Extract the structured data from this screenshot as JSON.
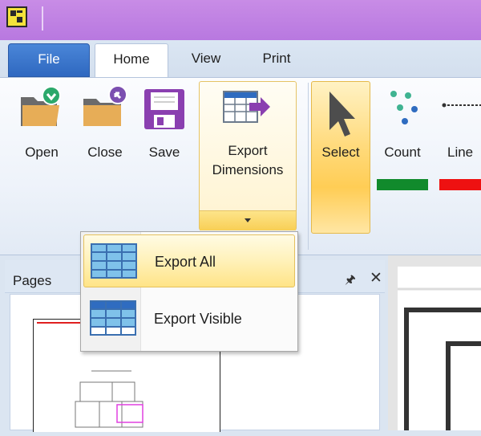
{
  "tabs": {
    "file": "File",
    "home": "Home",
    "view": "View",
    "print": "Print"
  },
  "ribbon": {
    "open": "Open",
    "close": "Close",
    "save": "Save",
    "export_line1": "Export",
    "export_line2": "Dimensions",
    "select": "Select",
    "count": "Count",
    "line": "Line",
    "count_color": "#118a2c",
    "line_color": "#ee1111"
  },
  "pages_panel": {
    "title": "Pages"
  },
  "export_menu": {
    "items": [
      {
        "label": "Export All",
        "highlighted": true
      },
      {
        "label": "Export Visible",
        "highlighted": false
      }
    ]
  },
  "icons": [
    "app-logo-icon",
    "open-folder-icon",
    "close-folder-icon",
    "save-icon",
    "export-dimensions-icon",
    "select-cursor-icon",
    "count-dots-icon",
    "line-dashed-icon",
    "pin-icon",
    "close-icon",
    "table-grid-icon"
  ]
}
